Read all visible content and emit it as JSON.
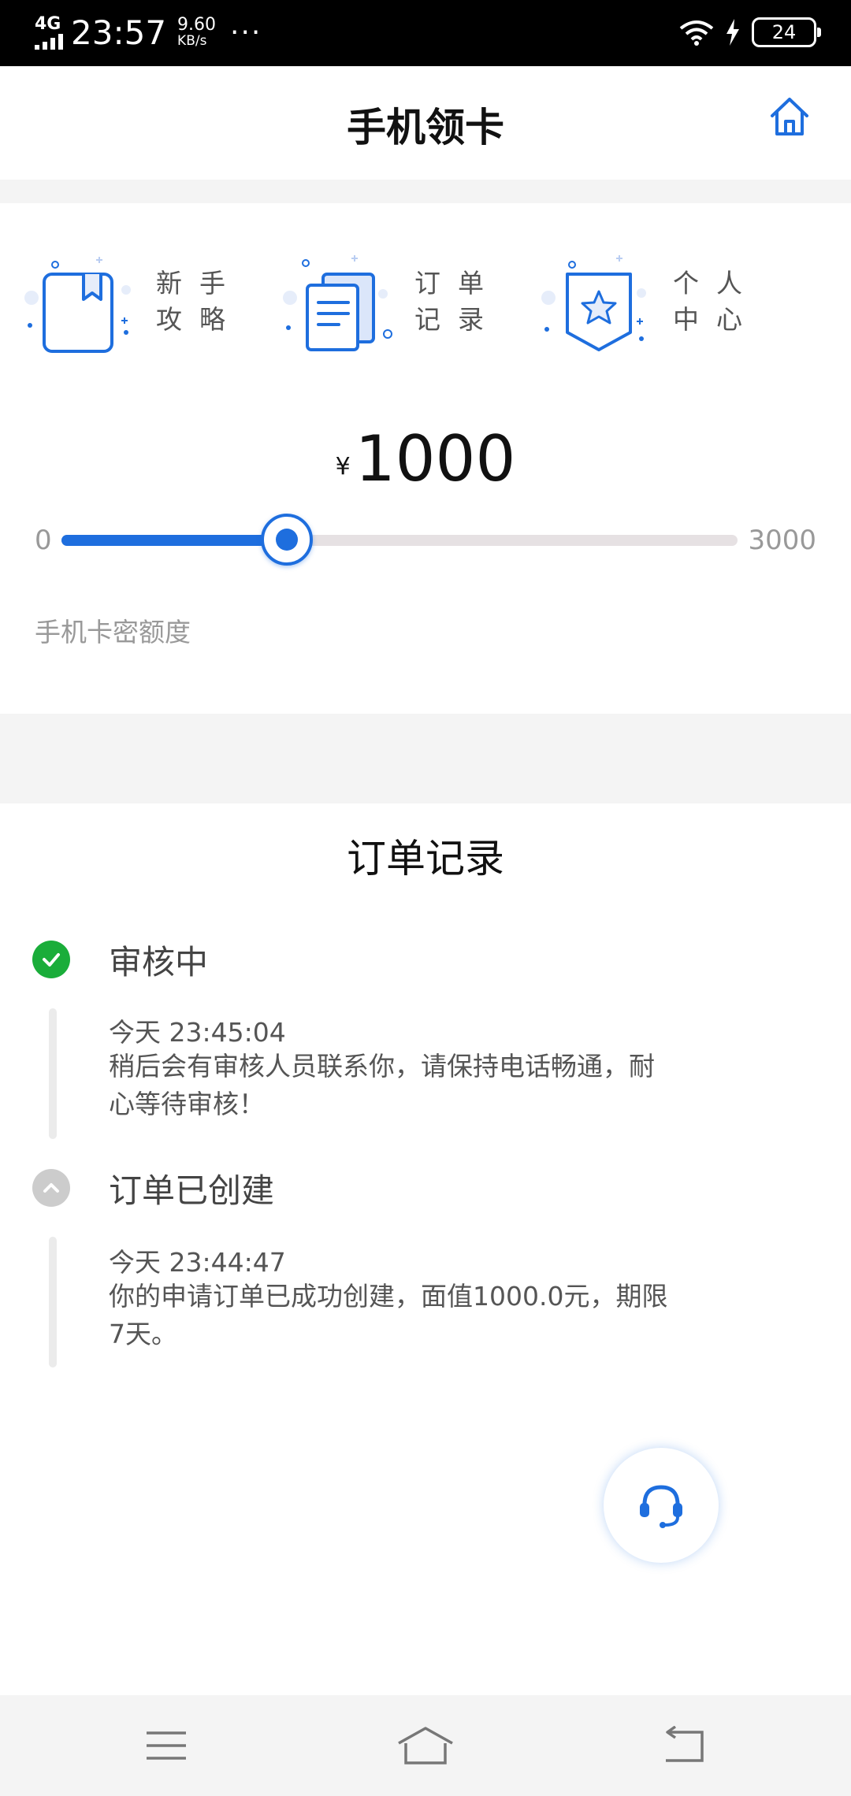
{
  "status_bar": {
    "network": "4G",
    "time": "23:57",
    "speed_value": "9.60",
    "speed_unit": "KB/s",
    "more": "···",
    "battery": "24"
  },
  "header": {
    "title": "手机领卡",
    "home_icon": "home-icon"
  },
  "shortcuts": [
    {
      "label": "新手攻略",
      "icon": "book-icon"
    },
    {
      "label": "订单记录",
      "icon": "document-icon"
    },
    {
      "label": "个人中心",
      "icon": "star-badge-icon"
    }
  ],
  "amount": {
    "currency": "¥",
    "value": "1000"
  },
  "slider": {
    "min": "0",
    "max": "3000",
    "value": 1000,
    "label": "手机卡密额度"
  },
  "orders": {
    "title": "订单记录",
    "steps": [
      {
        "title": "审核中",
        "time": "今天 23:45:04",
        "desc": "稍后会有审核人员联系你，请保持电话畅通，耐心等待审核！",
        "status": "done",
        "icon": "check-circle-icon"
      },
      {
        "title": "订单已创建",
        "time": "今天 23:44:47",
        "desc": "你的申请订单已成功创建，面值1000.0元，期限7天。",
        "status": "inactive",
        "icon": "chevron-up-icon"
      }
    ]
  },
  "service_icon": "headset-icon",
  "nav": [
    "menu-icon",
    "home-icon",
    "back-icon"
  ],
  "colors": {
    "accent": "#1e6ede",
    "success": "#1aad3a",
    "inactive": "#cccccc"
  }
}
